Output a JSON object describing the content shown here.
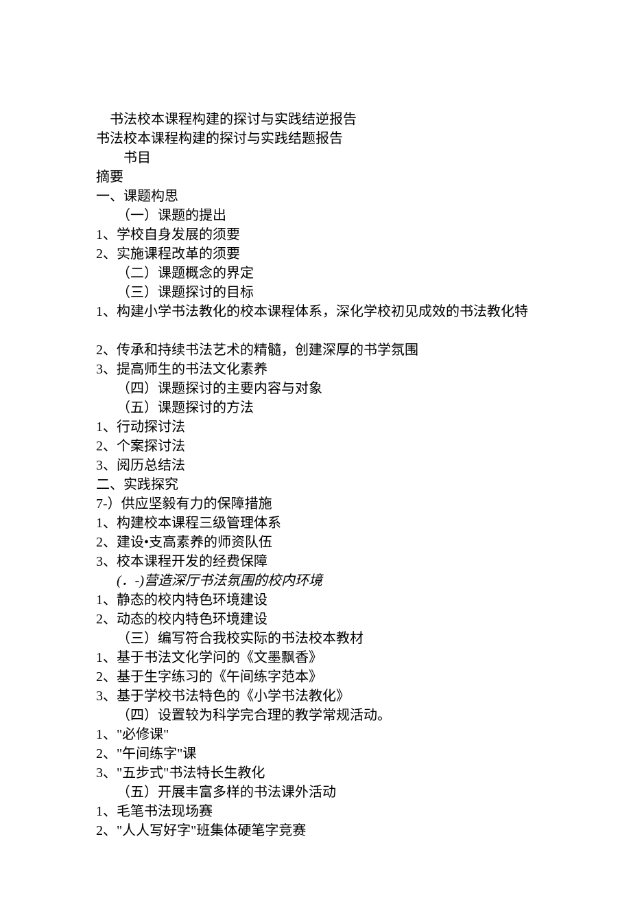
{
  "title": "书法校本课程构建的探讨与实践结逆报告",
  "subtitle": "书法校本课程构建的探讨与实践结题报告",
  "shumu_label": "书目",
  "lines": [
    {
      "text": "摘要",
      "cls": ""
    },
    {
      "text": "一、课题构思",
      "cls": ""
    },
    {
      "text": "（一）课题的提出",
      "cls": "indent1"
    },
    {
      "text": "1、学校自身发展的须要",
      "cls": ""
    },
    {
      "text": "2、实施课程改革的须要",
      "cls": ""
    },
    {
      "text": "（二）课题概念的界定",
      "cls": "indent1"
    },
    {
      "text": "（三）课题探讨的目标",
      "cls": "indent1"
    },
    {
      "text": "1、构建小学书法教化的校本课程体系，深化学校初见成效的书法教化特",
      "cls": ""
    },
    {
      "text": "",
      "cls": ""
    },
    {
      "text": "2、传承和持续书法艺术的精髓，创建深厚的书学氛围",
      "cls": ""
    },
    {
      "text": "3、提高师生的书法文化素养",
      "cls": ""
    },
    {
      "text": "（四）课题探讨的主要内容与对象",
      "cls": "indent1"
    },
    {
      "text": "（五）课题探讨的方法",
      "cls": "indent1"
    },
    {
      "text": "1、行动探讨法",
      "cls": ""
    },
    {
      "text": "2、个案探讨法",
      "cls": ""
    },
    {
      "text": "3、阅历总结法",
      "cls": ""
    },
    {
      "text": "二、实践探究",
      "cls": ""
    },
    {
      "text": "7-）供应坚毅有力的保障措施",
      "cls": ""
    },
    {
      "text": "1、构建校本课程三级管理体系",
      "cls": ""
    },
    {
      "text": "2、建设•支高素养的师资队伍",
      "cls": ""
    },
    {
      "text": "3、校本课程开发的经费保障",
      "cls": ""
    },
    {
      "text": "(．-)营造深厅书法氛围的校内环境",
      "cls": "indent1 italic"
    },
    {
      "text": "1、静态的校内特色环境建设",
      "cls": ""
    },
    {
      "text": "2、动态的校内特色环境建设",
      "cls": ""
    },
    {
      "text": "（三）编写符合我校实际的书法校本教材",
      "cls": "indent1"
    },
    {
      "text": "1、基于书法文化学问的《文墨飘香》",
      "cls": ""
    },
    {
      "text": "2、基于生字练习的《午间练字范本》",
      "cls": ""
    },
    {
      "text": "3、基于学校书法特色的《小学书法教化》",
      "cls": ""
    },
    {
      "text": "（四）设置较为科学完合理的教学常规活动。",
      "cls": "indent1"
    },
    {
      "text": "1、\"必修课\"",
      "cls": ""
    },
    {
      "text": "2、\"午间练字\"课",
      "cls": ""
    },
    {
      "text": "3、\"五步式\"书法特长生教化",
      "cls": ""
    },
    {
      "text": "（五）开展丰富多样的书法课外活动",
      "cls": "indent1"
    },
    {
      "text": "1、毛笔书法现场赛",
      "cls": ""
    },
    {
      "text": "2、\"人人写好字\"班集体硬笔字竞赛",
      "cls": ""
    }
  ]
}
